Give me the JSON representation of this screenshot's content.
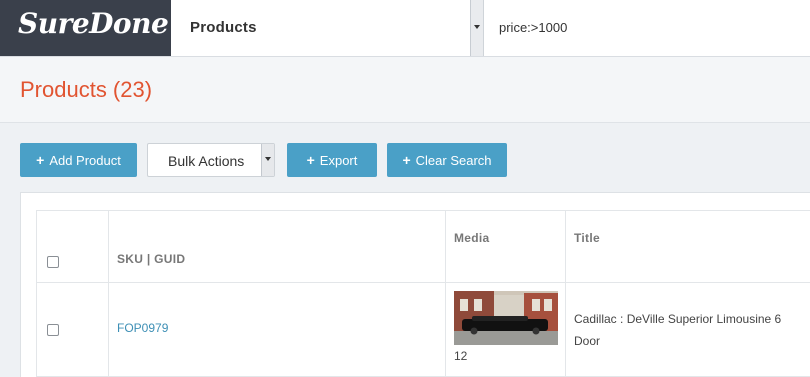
{
  "app": {
    "logo_text": "SureDone",
    "module_select_value": "Products",
    "search_value": "price:>1000"
  },
  "page": {
    "title": "Products (23)"
  },
  "toolbar": {
    "add_product_label": "Add Product",
    "bulk_actions_label": "Bulk Actions",
    "export_label": "Export",
    "clear_search_label": "Clear Search"
  },
  "table": {
    "headers": {
      "sku": "SKU | GUID",
      "media": "Media",
      "title": "Title"
    },
    "rows": [
      {
        "sku": "FOP0979",
        "media_count": "12",
        "title": "Cadillac : DeVille Superior Limousine 6 Door"
      }
    ]
  },
  "colors": {
    "accent_blue": "#4aa0c7",
    "title_orange": "#e15431",
    "logo_bg": "#3a404b",
    "link_blue": "#3d8fb5"
  },
  "icons": {
    "add": "plus-icon",
    "export": "plus-icon",
    "clear_search": "plus-icon",
    "dropdown": "caret-down-icon"
  }
}
